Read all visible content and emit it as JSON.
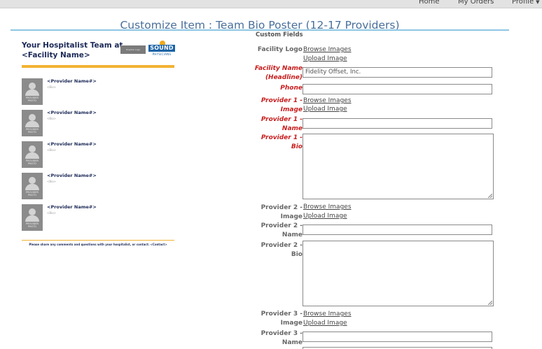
{
  "nav": {
    "home": "Home",
    "orders": "My Orders",
    "profile": "Profile"
  },
  "page_title": "Customize Item : Team Bio Poster (12-17 Providers)",
  "section_heading": "Custom Fields",
  "poster": {
    "headline_line1": "Your Hospitalist Team at",
    "headline_line2": "<Facility Name>",
    "placeholder_logo": "Hospital Logo",
    "brand_name": "SOUND",
    "brand_sub": "PHYSICIANS",
    "photo_label": "PROVIDER PHOTO",
    "provider_name": "<Provider Name#>",
    "provider_bio": "<Bio>",
    "footer": "Please share any comments and questions with your hospitalist, or contact: <Contact>"
  },
  "links": {
    "browse": "Browse Images",
    "upload": "Upload Image"
  },
  "fields": {
    "facility_logo": "Facility Logo",
    "facility_name_1": "Facility Name",
    "facility_name_2": "(Headline)",
    "facility_name_value": "Fidelity Offset, Inc.",
    "phone": "Phone",
    "p1_image_1": "Provider 1 -",
    "p1_image_2": "Image",
    "p1_name_1": "Provider 1 -",
    "p1_name_2": "Name",
    "p1_bio_1": "Provider 1 -",
    "p1_bio_2": "Bio",
    "p2_image_1": "Provider 2 -",
    "p2_image_2": "Image",
    "p2_name_1": "Provider 2 -",
    "p2_name_2": "Name",
    "p2_bio_1": "Provider 2 -",
    "p2_bio_2": "Bio",
    "p3_image_1": "Provider 3 -",
    "p3_image_2": "Image",
    "p3_name_1": "Provider 3 -",
    "p3_name_2": "Name"
  },
  "colors": {
    "required_label": "#c81d1d",
    "title": "#4a6f9a",
    "accent_rule": "#8ec6e3",
    "poster_gold": "#f2b233",
    "poster_navy": "#1c2a57"
  }
}
